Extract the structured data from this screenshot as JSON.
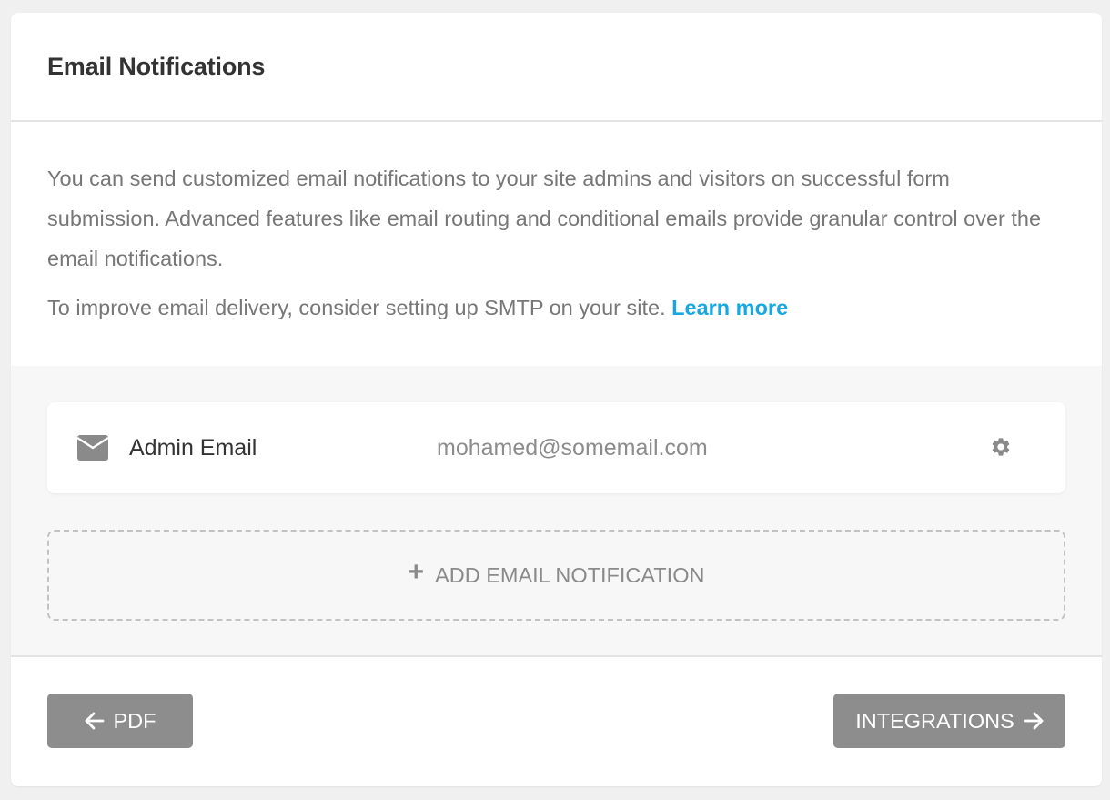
{
  "section": {
    "title": "Email Notifications",
    "description": "You can send customized email notifications to your site admins and visitors on successful form submission. Advanced features like email routing and conditional emails provide granular control over the email notifications.",
    "smtp_text": "To improve email delivery, consider setting up SMTP on your site.",
    "learn_more_label": "Learn more"
  },
  "notifications": [
    {
      "icon": "mail-icon",
      "name": "Admin Email",
      "email": "mohamed@somemail.com",
      "settings_icon": "gear-icon"
    }
  ],
  "add_notification": {
    "icon": "plus-icon",
    "label": "ADD EMAIL NOTIFICATION"
  },
  "navigation": {
    "prev_label": "PDF",
    "prev_icon": "arrow-left-icon",
    "next_label": "INTEGRATIONS",
    "next_icon": "arrow-right-icon"
  },
  "colors": {
    "link": "#17a8e3",
    "button_bg": "#8d8d8d",
    "text_primary": "#333333",
    "text_secondary": "#777777"
  }
}
